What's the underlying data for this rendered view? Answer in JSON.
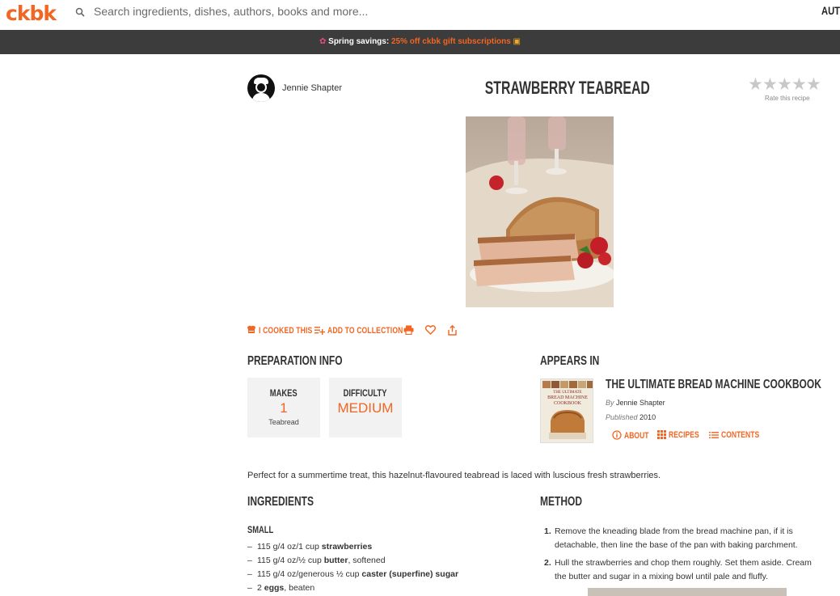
{
  "header": {
    "logo": "ckbk",
    "search_placeholder": "Search ingredients, dishes, authors, books and more...",
    "auth_label": "AUTI"
  },
  "promo": {
    "lead": "Spring savings:",
    "highlight": "25% off ckbk gift subscriptions"
  },
  "recipe": {
    "author": "Jennie Shapter",
    "title": "STRAWBERRY TEABREAD",
    "rating_stars": 5,
    "rate_label": "Rate this recipe"
  },
  "actions": {
    "cooked": "I COOKED THIS",
    "add_collection": "ADD TO COLLECTION"
  },
  "prep": {
    "heading": "PREPARATION INFO",
    "makes_label": "MAKES",
    "makes_value": "1",
    "makes_unit": "Teabread",
    "difficulty_label": "DIFFICULTY",
    "difficulty_value": "MEDIUM"
  },
  "appears_in": {
    "heading": "APPEARS IN",
    "book_title": "THE ULTIMATE BREAD MACHINE COOKBOOK",
    "by_label": "By",
    "book_author": "Jennie Shapter",
    "published_label": "Published",
    "published_year": "2010",
    "about": "ABOUT",
    "recipes": "RECIPES",
    "contents": "CONTENTS",
    "cover_lines": [
      "THE ULTIMATE",
      "BREAD MACHINE",
      "COOKBOOK"
    ]
  },
  "description": "Perfect for a summertime treat, this hazelnut-flavoured teabread is laced with luscious fresh strawberries.",
  "ingredients": {
    "heading": "INGREDIENTS",
    "subheading": "SMALL",
    "items": [
      {
        "pre": "115 g/4 oz/1 cup ",
        "bold": "strawberries",
        "post": ""
      },
      {
        "pre": "115 g/4 oz/½ cup ",
        "bold": "butter",
        "post": ", softened"
      },
      {
        "pre": "115 g/4 oz/generous ½ cup ",
        "bold": "caster (superfine) sugar",
        "post": ""
      },
      {
        "pre": "2 ",
        "bold": "eggs",
        "post": ", beaten"
      }
    ]
  },
  "method": {
    "heading": "METHOD",
    "steps": [
      {
        "num": "1.",
        "text": "Remove the kneading blade from the bread machine pan, if it is detachable, then line the base of the pan with baking parchment."
      },
      {
        "num": "2.",
        "text": "Hull the strawberries and chop them roughly. Set them aside. Cream the butter and sugar in a mixing bowl until pale and fluffy."
      }
    ]
  },
  "colors": {
    "accent": "#f26522",
    "promo_bg": "#3c3c3c",
    "info_bg": "#f2f2f2",
    "star": "#c8c8c8"
  }
}
